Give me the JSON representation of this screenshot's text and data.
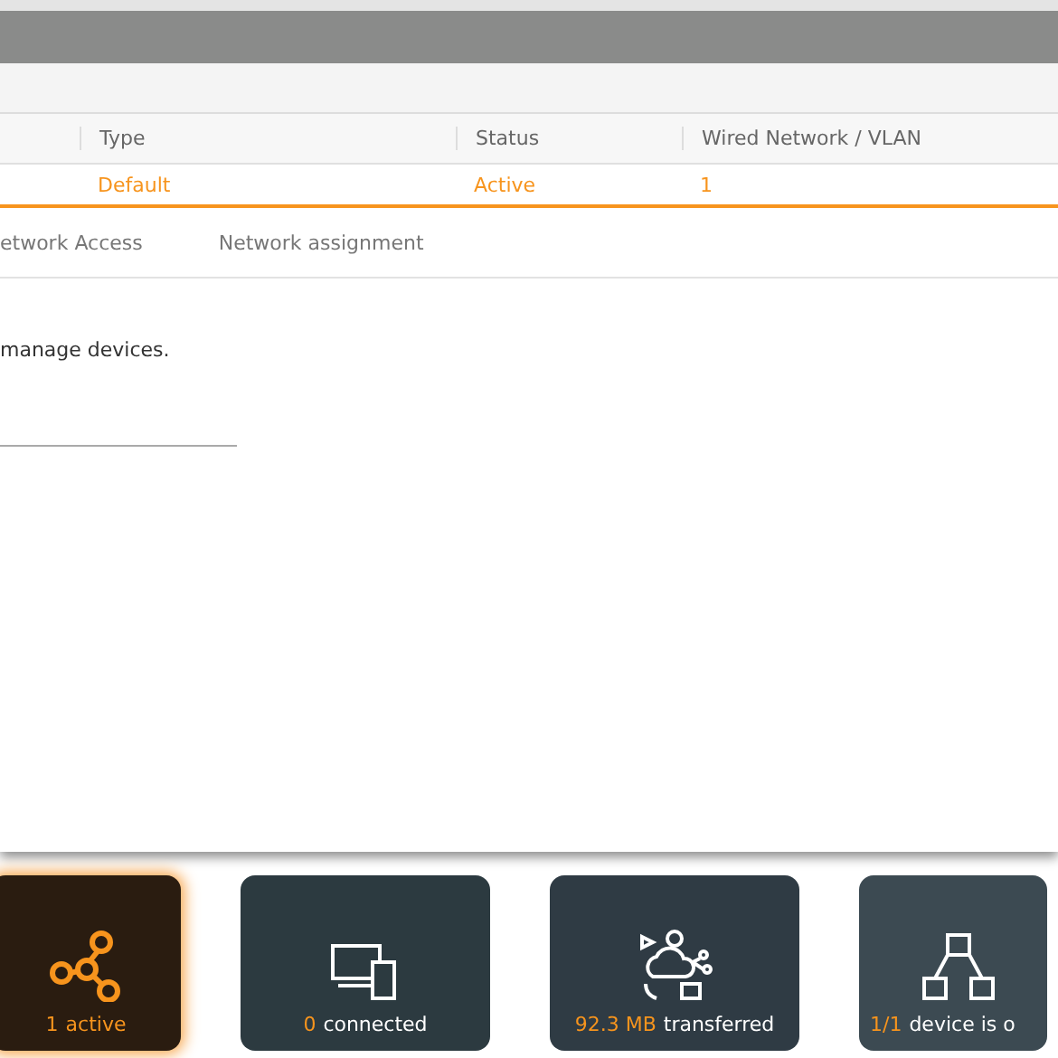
{
  "table": {
    "columns": [
      "Type",
      "Status",
      "Wired Network / VLAN"
    ],
    "rows": [
      {
        "cells": [
          "Default",
          "Active",
          "1"
        ],
        "selected": true
      }
    ]
  },
  "tabs": [
    {
      "label": "etwork Access",
      "selected": false
    },
    {
      "label": "Network assignment",
      "selected": false
    }
  ],
  "description": "manage devices.",
  "cards": [
    {
      "kind": "network",
      "value": "1",
      "label": "active",
      "selected": true
    },
    {
      "kind": "devices",
      "value": "0",
      "label": "connected",
      "selected": false
    },
    {
      "kind": "transfer",
      "value": "92.3 MB",
      "label": "transferred",
      "selected": false
    },
    {
      "kind": "hardware",
      "value": "1/1",
      "label": "device is o",
      "selected": false
    }
  ]
}
